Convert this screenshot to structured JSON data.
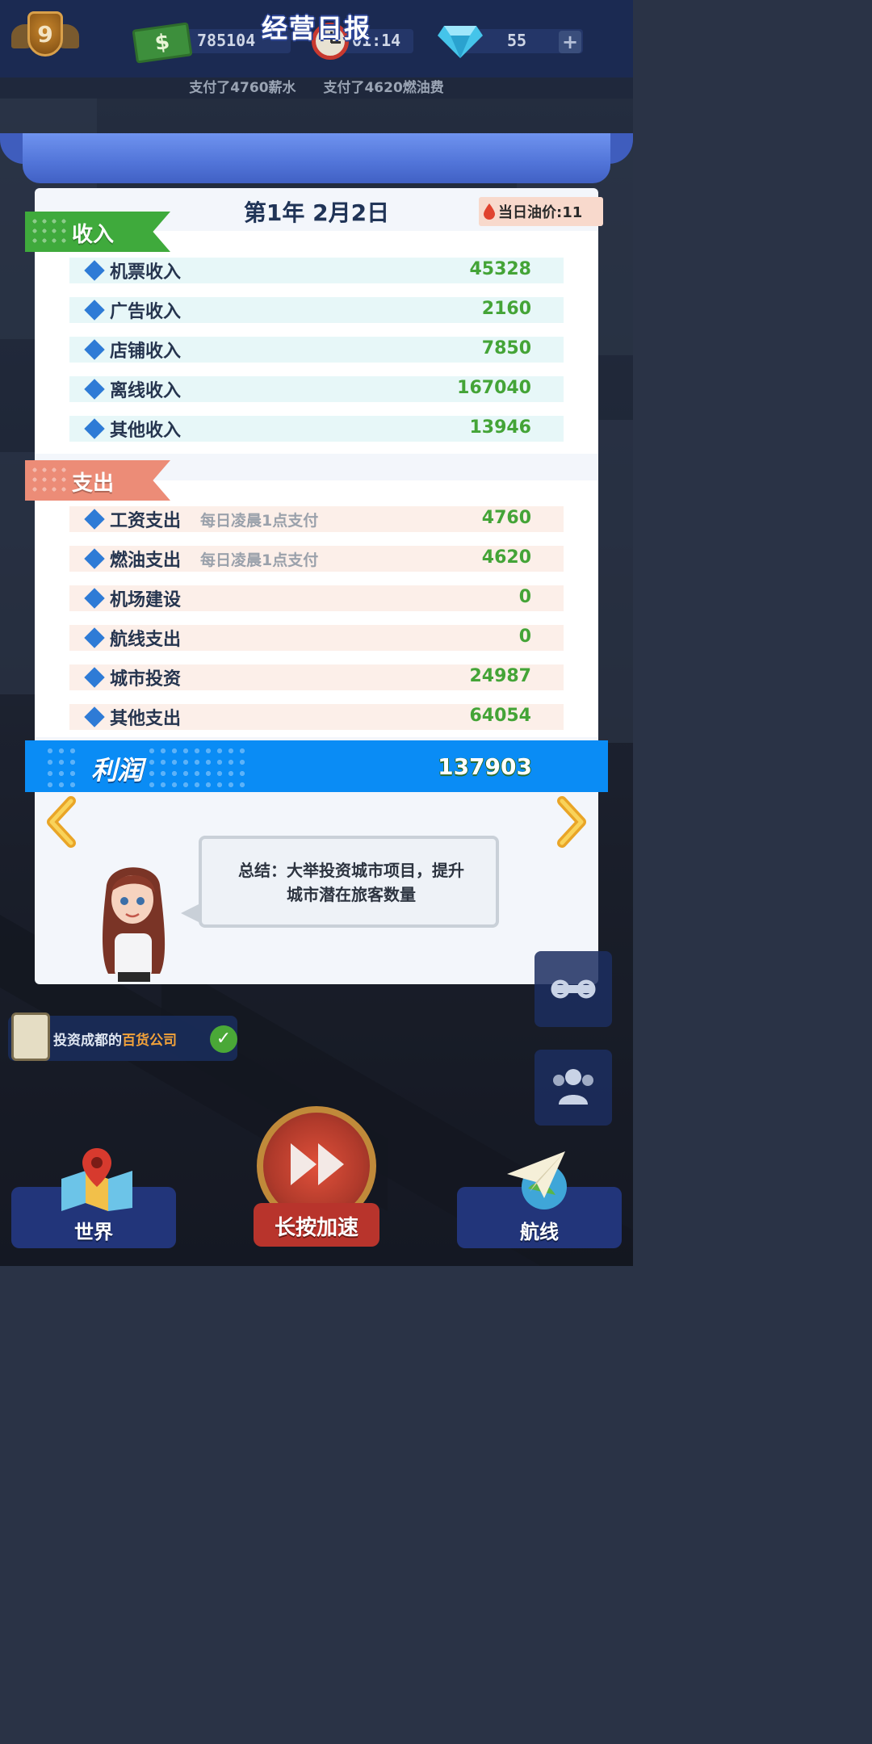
{
  "hud": {
    "level": "9",
    "money_symbol": "$",
    "money": "785104",
    "timer": "01:14",
    "gems": "55",
    "plus_symbol": "+"
  },
  "ticker": {
    "items": [
      "支付了4760薪水",
      "支付了4620燃油费"
    ]
  },
  "report": {
    "title": "经营日报",
    "date": "第1年 2月2日",
    "oil_price_label": "当日油价:11",
    "income": {
      "label": "收入",
      "rows": [
        {
          "label": "机票收入",
          "note": "",
          "value": "45328"
        },
        {
          "label": "广告收入",
          "note": "",
          "value": "2160"
        },
        {
          "label": "店铺收入",
          "note": "",
          "value": "7850"
        },
        {
          "label": "离线收入",
          "note": "",
          "value": "167040"
        },
        {
          "label": "其他收入",
          "note": "",
          "value": "13946"
        }
      ]
    },
    "expense": {
      "label": "支出",
      "rows": [
        {
          "label": "工资支出",
          "note": "每日凌晨1点支付",
          "value": "4760"
        },
        {
          "label": "燃油支出",
          "note": "每日凌晨1点支付",
          "value": "4620"
        },
        {
          "label": "机场建设",
          "note": "",
          "value": "0"
        },
        {
          "label": "航线支出",
          "note": "",
          "value": "0"
        },
        {
          "label": "城市投资",
          "note": "",
          "value": "24987"
        },
        {
          "label": "其他支出",
          "note": "",
          "value": "64054"
        }
      ]
    },
    "profit": {
      "label": "利润",
      "value": "137903"
    },
    "summary_line1": "总结：大举投资城市项目，提升",
    "summary_line2": "城市潜在旅客数量"
  },
  "task": {
    "prefix": "投资成都的",
    "highlight": "百货公司"
  },
  "nav": {
    "world": "世界",
    "speed": "长按加速",
    "routes": "航线"
  },
  "colors": {
    "income_green": "#44a437",
    "income_tab": "#3faa3c",
    "expense_tab": "#ec8c77",
    "profit_blue": "#0a8cf5",
    "header_blue": "#5174d8"
  }
}
